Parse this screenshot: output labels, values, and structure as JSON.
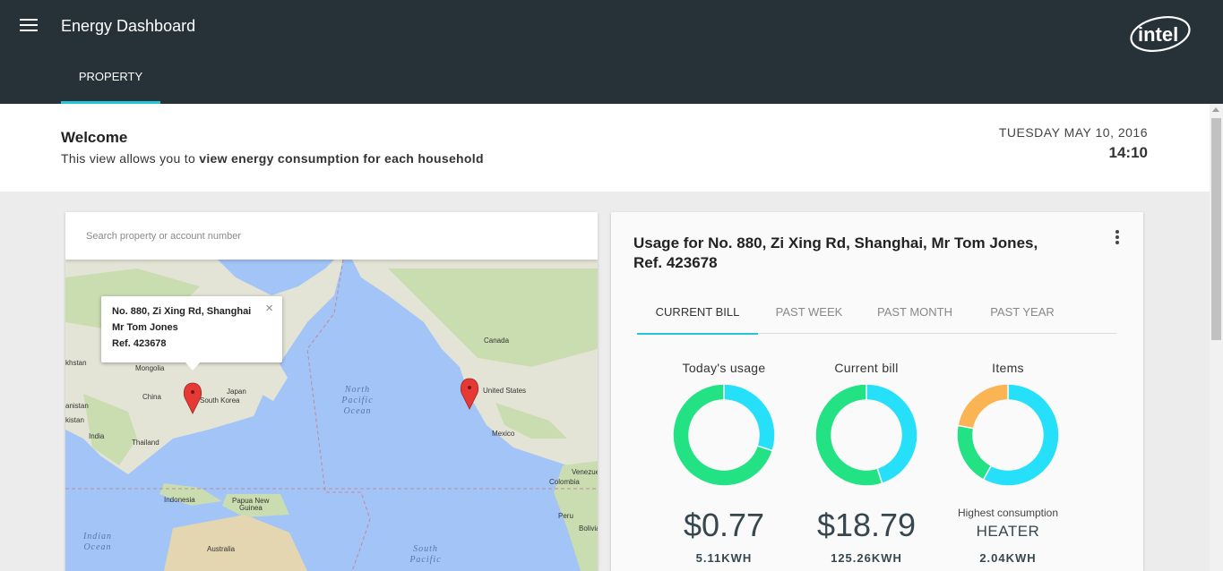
{
  "app": {
    "title": "Energy Dashboard",
    "logo_text": "intel"
  },
  "nav": {
    "tabs": [
      {
        "label": "PROPERTY"
      }
    ]
  },
  "welcome": {
    "title": "Welcome",
    "desc_prefix": "This view allows you to ",
    "desc_bold": "view energy consumption for each household",
    "date": "TUESDAY MAY 10, 2016",
    "time": "14:10"
  },
  "search": {
    "placeholder": "Search property or account number"
  },
  "map": {
    "popup": {
      "line1": "No. 880, Zi Xing Rd, Shanghai",
      "line2": "Mr Tom Jones",
      "line3": "Ref. 423678",
      "close": "×"
    },
    "labels": {
      "mongolia": "Mongolia",
      "china": "China",
      "japan": "Japan",
      "south_korea": "South Korea",
      "thailand": "Thailand",
      "india": "India",
      "indonesia": "Indonesia",
      "papua": "Papua New",
      "papua2": "Guinea",
      "australia": "Australia",
      "north_pacific_1": "North",
      "north_pacific_2": "Pacific",
      "north_pacific_3": "Ocean",
      "indian_1": "Indian",
      "indian_2": "Ocean",
      "south_pacific_1": "South",
      "south_pacific_2": "Pacific",
      "canada": "Canada",
      "united_states": "United States",
      "mexico": "Mexico",
      "venezuela": "Venezue",
      "colombia": "Colombia",
      "peru": "Peru",
      "bolivia": "Bolivia",
      "khstan": "khstan",
      "anistan": "anistan",
      "kistan": "kistan"
    }
  },
  "usage": {
    "title_line1": "Usage for No. 880, Zi Xing Rd, Shanghai, Mr Tom Jones,",
    "title_line2": "Ref. 423678",
    "tabs": [
      {
        "label": "CURRENT BILL"
      },
      {
        "label": "PAST WEEK"
      },
      {
        "label": "PAST MONTH"
      },
      {
        "label": "PAST YEAR"
      }
    ],
    "stats": [
      {
        "label": "Today's usage",
        "amount": "$0.77",
        "kwh": "5.11KWH"
      },
      {
        "label": "Current bill",
        "amount": "$18.79",
        "kwh": "125.26KWH"
      },
      {
        "label": "Items",
        "sub": "Highest consumption",
        "big": "HEATER",
        "kwh": "2.04KWH"
      }
    ]
  },
  "colors": {
    "header": "#263238",
    "accent": "#26c6da",
    "cyan": "#26e0fa",
    "green": "#22e284",
    "orange": "#fbb454"
  },
  "chart_data": [
    {
      "type": "pie",
      "title": "Today's usage",
      "values": [
        0.3,
        0.7
      ],
      "colors": [
        "#26e0fa",
        "#22e284"
      ]
    },
    {
      "type": "pie",
      "title": "Current bill",
      "values": [
        0.45,
        0.55
      ],
      "colors": [
        "#26e0fa",
        "#22e284"
      ]
    },
    {
      "type": "pie",
      "title": "Items",
      "values": [
        0.58,
        0.2,
        0.22
      ],
      "colors": [
        "#26e0fa",
        "#22e284",
        "#fbb454"
      ]
    }
  ]
}
